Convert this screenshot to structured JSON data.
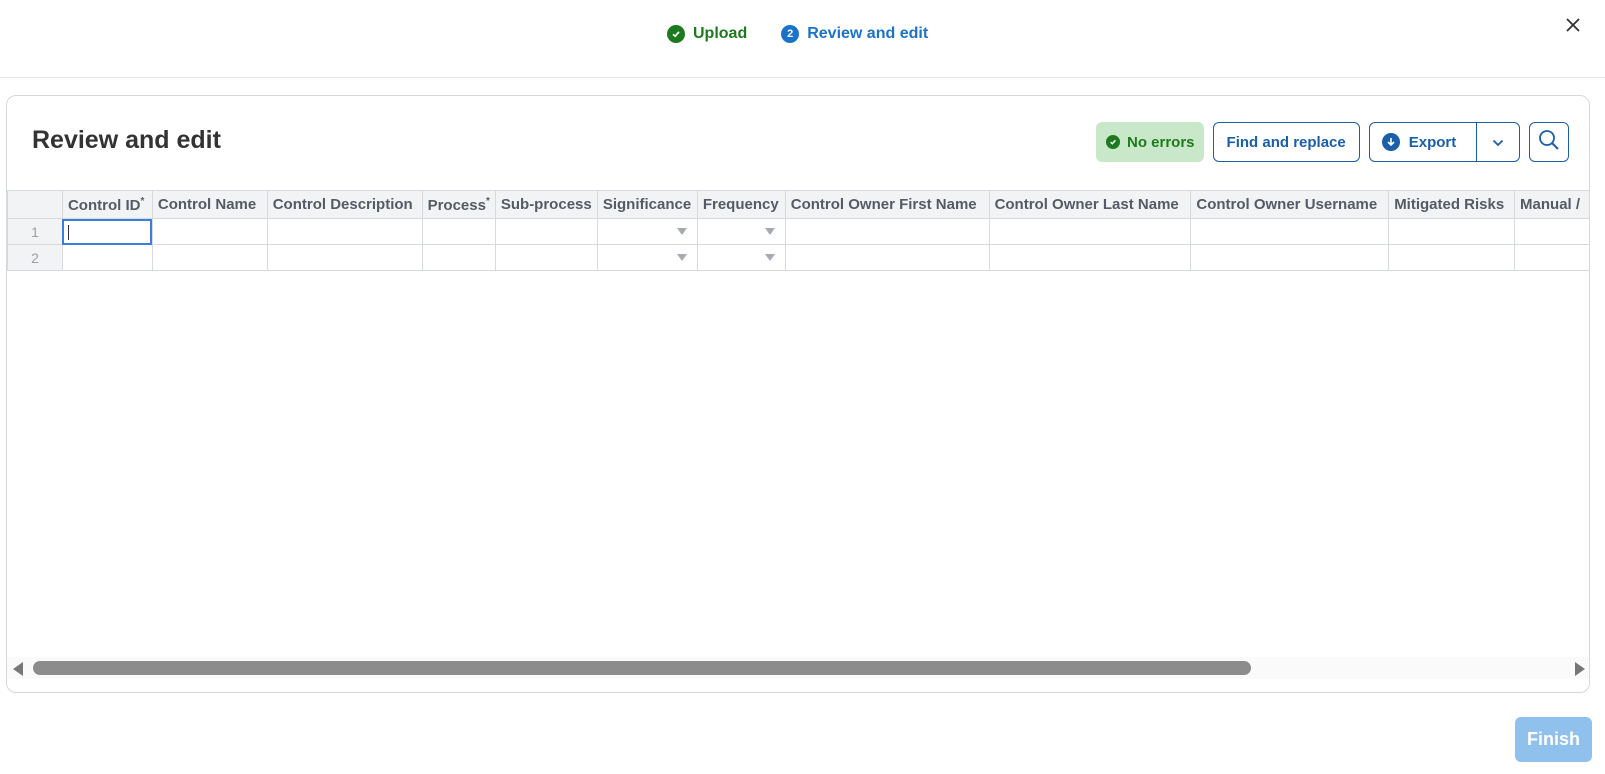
{
  "stepper": {
    "steps": [
      {
        "label": "Upload",
        "state": "done",
        "icon": "check-circle-icon"
      },
      {
        "label": "Review and edit",
        "state": "active",
        "number": "2"
      }
    ]
  },
  "close": {
    "icon": "close-icon"
  },
  "panel": {
    "title": "Review and edit",
    "status_badge": "No errors",
    "find_replace_label": "Find and replace",
    "export_label": "Export"
  },
  "grid": {
    "columns": [
      {
        "label": "Control ID",
        "required": true
      },
      {
        "label": "Control Name",
        "required": false
      },
      {
        "label": "Control Description",
        "required": false
      },
      {
        "label": "Process",
        "required": true
      },
      {
        "label": "Sub-process",
        "required": false
      },
      {
        "label": "Significance",
        "required": false,
        "dropdown": true
      },
      {
        "label": "Frequency",
        "required": false,
        "dropdown": true
      },
      {
        "label": "Control Owner First Name",
        "required": false
      },
      {
        "label": "Control Owner Last Name",
        "required": false
      },
      {
        "label": "Control Owner Username",
        "required": false
      },
      {
        "label": "Mitigated Risks",
        "required": false
      },
      {
        "label": "Manual /",
        "required": false
      }
    ],
    "rows": [
      {
        "number": "1"
      },
      {
        "number": "2"
      }
    ],
    "required_marker": "*"
  },
  "footer": {
    "finish_label": "Finish"
  },
  "colors": {
    "success": "#1e7a1e",
    "accent": "#1a73c9",
    "button_border": "#1a5fa8",
    "finish_disabled": "#90c0ec"
  }
}
